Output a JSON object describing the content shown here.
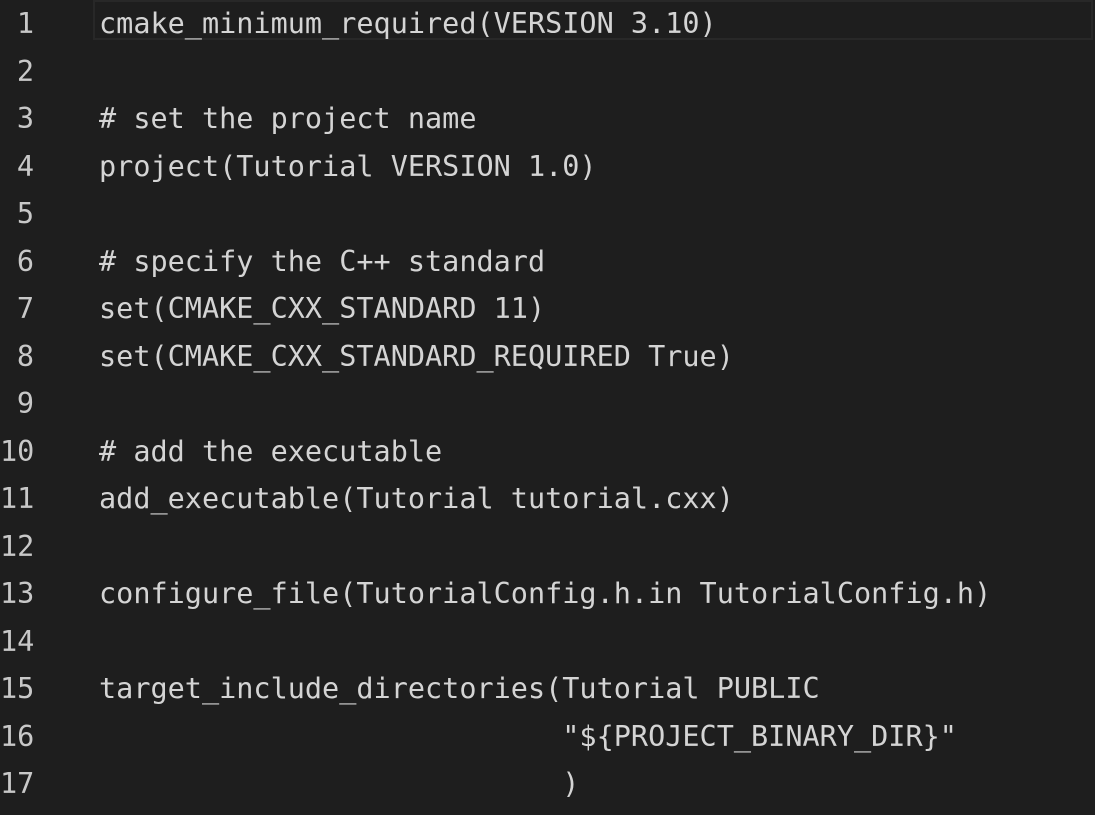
{
  "editor": {
    "colors": {
      "background": "#1e1e1e",
      "text": "#d4d4d4",
      "line_number": "#c8c8c8",
      "current_line_border": "#282828"
    },
    "current_line": 1,
    "lines": [
      {
        "number": "1",
        "text": "cmake_minimum_required(VERSION 3.10)"
      },
      {
        "number": "2",
        "text": ""
      },
      {
        "number": "3",
        "text": "# set the project name"
      },
      {
        "number": "4",
        "text": "project(Tutorial VERSION 1.0)"
      },
      {
        "number": "5",
        "text": ""
      },
      {
        "number": "6",
        "text": "# specify the C++ standard"
      },
      {
        "number": "7",
        "text": "set(CMAKE_CXX_STANDARD 11)"
      },
      {
        "number": "8",
        "text": "set(CMAKE_CXX_STANDARD_REQUIRED True)"
      },
      {
        "number": "9",
        "text": ""
      },
      {
        "number": "10",
        "text": "# add the executable"
      },
      {
        "number": "11",
        "text": "add_executable(Tutorial tutorial.cxx)"
      },
      {
        "number": "12",
        "text": ""
      },
      {
        "number": "13",
        "text": "configure_file(TutorialConfig.h.in TutorialConfig.h)"
      },
      {
        "number": "14",
        "text": ""
      },
      {
        "number": "15",
        "text": "target_include_directories(Tutorial PUBLIC"
      },
      {
        "number": "16",
        "text": "                           \"${PROJECT_BINARY_DIR}\""
      },
      {
        "number": "17",
        "text": "                           )"
      }
    ]
  }
}
